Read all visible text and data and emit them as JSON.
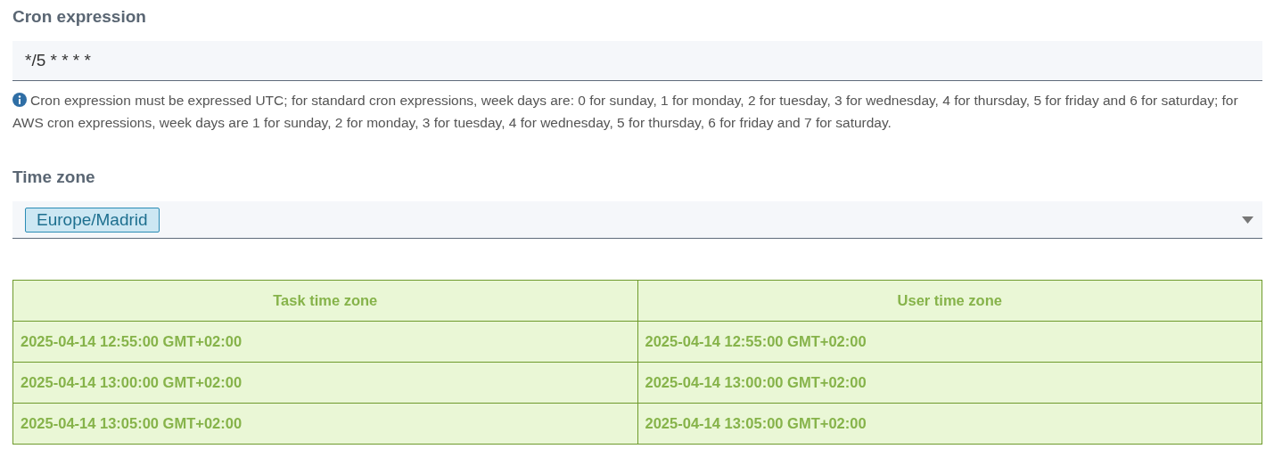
{
  "cron_expression": {
    "label": "Cron expression",
    "value": "*/5 * * * *",
    "help": "Cron expression must be expressed UTC; for standard cron expressions, week days are: 0 for sunday, 1 for monday, 2 for tuesday, 3 for wednesday, 4 for thursday, 5 for friday and 6 for saturday; for AWS cron expressions, week days are 1 for sunday, 2 for monday, 3 for tuesday, 4 for wednesday, 5 for thursday, 6 for friday and 7 for saturday."
  },
  "time_zone": {
    "label": "Time zone",
    "selected_tag": "Europe/Madrid"
  },
  "table": {
    "columns": [
      "Task time zone",
      "User time zone"
    ],
    "rows": [
      [
        "2025-04-14 12:55:00 GMT+02:00",
        "2025-04-14 12:55:00 GMT+02:00"
      ],
      [
        "2025-04-14 13:00:00 GMT+02:00",
        "2025-04-14 13:00:00 GMT+02:00"
      ],
      [
        "2025-04-14 13:05:00 GMT+02:00",
        "2025-04-14 13:05:00 GMT+02:00"
      ]
    ]
  }
}
